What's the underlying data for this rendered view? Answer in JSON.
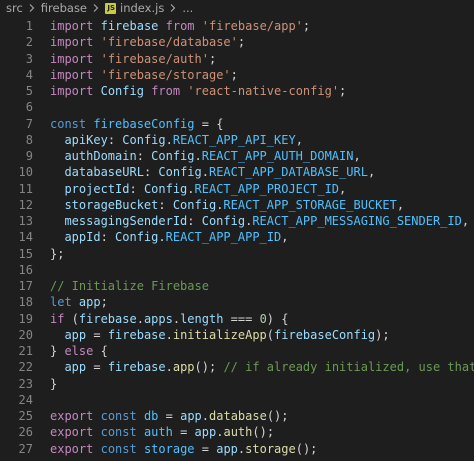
{
  "breadcrumb": {
    "items": [
      "src",
      "firebase",
      "index.js",
      "..."
    ]
  },
  "editor": {
    "lines": [
      {
        "n": "1",
        "tokens": [
          [
            "kw",
            "import"
          ],
          [
            "pun",
            " "
          ],
          [
            "var",
            "firebase"
          ],
          [
            "pun",
            " "
          ],
          [
            "kw",
            "from"
          ],
          [
            "pun",
            " "
          ],
          [
            "str",
            "'firebase/app'"
          ],
          [
            "pun",
            ";"
          ]
        ]
      },
      {
        "n": "2",
        "tokens": [
          [
            "kw",
            "import"
          ],
          [
            "pun",
            " "
          ],
          [
            "str",
            "'firebase/database'"
          ],
          [
            "pun",
            ";"
          ]
        ]
      },
      {
        "n": "3",
        "tokens": [
          [
            "kw",
            "import"
          ],
          [
            "pun",
            " "
          ],
          [
            "str",
            "'firebase/auth'"
          ],
          [
            "pun",
            ";"
          ]
        ]
      },
      {
        "n": "4",
        "tokens": [
          [
            "kw",
            "import"
          ],
          [
            "pun",
            " "
          ],
          [
            "str",
            "'firebase/storage'"
          ],
          [
            "pun",
            ";"
          ]
        ]
      },
      {
        "n": "5",
        "tokens": [
          [
            "kw",
            "import"
          ],
          [
            "pun",
            " "
          ],
          [
            "var",
            "Config"
          ],
          [
            "pun",
            " "
          ],
          [
            "kw",
            "from"
          ],
          [
            "pun",
            " "
          ],
          [
            "str",
            "'react-native-config'"
          ],
          [
            "pun",
            ";"
          ]
        ]
      },
      {
        "n": "6",
        "tokens": []
      },
      {
        "n": "7",
        "tokens": [
          [
            "kb",
            "const"
          ],
          [
            "pun",
            " "
          ],
          [
            "const",
            "firebaseConfig"
          ],
          [
            "pun",
            " = {"
          ]
        ]
      },
      {
        "n": "8",
        "tokens": [
          [
            "pun",
            "  "
          ],
          [
            "var",
            "apiKey"
          ],
          [
            "pun",
            ": "
          ],
          [
            "var",
            "Config"
          ],
          [
            "pun",
            "."
          ],
          [
            "const",
            "REACT_APP_API_KEY"
          ],
          [
            "pun",
            ","
          ]
        ]
      },
      {
        "n": "9",
        "tokens": [
          [
            "pun",
            "  "
          ],
          [
            "var",
            "authDomain"
          ],
          [
            "pun",
            ": "
          ],
          [
            "var",
            "Config"
          ],
          [
            "pun",
            "."
          ],
          [
            "const",
            "REACT_APP_AUTH_DOMAIN"
          ],
          [
            "pun",
            ","
          ]
        ]
      },
      {
        "n": "10",
        "tokens": [
          [
            "pun",
            "  "
          ],
          [
            "var",
            "databaseURL"
          ],
          [
            "pun",
            ": "
          ],
          [
            "var",
            "Config"
          ],
          [
            "pun",
            "."
          ],
          [
            "const",
            "REACT_APP_DATABASE_URL"
          ],
          [
            "pun",
            ","
          ]
        ]
      },
      {
        "n": "11",
        "tokens": [
          [
            "pun",
            "  "
          ],
          [
            "var",
            "projectId"
          ],
          [
            "pun",
            ": "
          ],
          [
            "var",
            "Config"
          ],
          [
            "pun",
            "."
          ],
          [
            "const",
            "REACT_APP_PROJECT_ID"
          ],
          [
            "pun",
            ","
          ]
        ]
      },
      {
        "n": "12",
        "tokens": [
          [
            "pun",
            "  "
          ],
          [
            "var",
            "storageBucket"
          ],
          [
            "pun",
            ": "
          ],
          [
            "var",
            "Config"
          ],
          [
            "pun",
            "."
          ],
          [
            "const",
            "REACT_APP_STORAGE_BUCKET"
          ],
          [
            "pun",
            ","
          ]
        ]
      },
      {
        "n": "13",
        "tokens": [
          [
            "pun",
            "  "
          ],
          [
            "var",
            "messagingSenderId"
          ],
          [
            "pun",
            ": "
          ],
          [
            "var",
            "Config"
          ],
          [
            "pun",
            "."
          ],
          [
            "const",
            "REACT_APP_MESSAGING_SENDER_ID"
          ],
          [
            "pun",
            ","
          ]
        ]
      },
      {
        "n": "14",
        "tokens": [
          [
            "pun",
            "  "
          ],
          [
            "var",
            "appId"
          ],
          [
            "pun",
            ": "
          ],
          [
            "var",
            "Config"
          ],
          [
            "pun",
            "."
          ],
          [
            "const",
            "REACT_APP_APP_ID"
          ],
          [
            "pun",
            ","
          ]
        ]
      },
      {
        "n": "15",
        "tokens": [
          [
            "pun",
            "};"
          ]
        ]
      },
      {
        "n": "16",
        "tokens": []
      },
      {
        "n": "17",
        "tokens": [
          [
            "cm",
            "// Initialize Firebase"
          ]
        ]
      },
      {
        "n": "18",
        "tokens": [
          [
            "kb",
            "let"
          ],
          [
            "pun",
            " "
          ],
          [
            "var",
            "app"
          ],
          [
            "pun",
            ";"
          ]
        ]
      },
      {
        "n": "19",
        "tokens": [
          [
            "kw",
            "if"
          ],
          [
            "pun",
            " ("
          ],
          [
            "var",
            "firebase"
          ],
          [
            "pun",
            "."
          ],
          [
            "var",
            "apps"
          ],
          [
            "pun",
            "."
          ],
          [
            "var",
            "length"
          ],
          [
            "pun",
            " === "
          ],
          [
            "num",
            "0"
          ],
          [
            "pun",
            ") {"
          ]
        ]
      },
      {
        "n": "20",
        "tokens": [
          [
            "pun",
            "  "
          ],
          [
            "var",
            "app"
          ],
          [
            "pun",
            " = "
          ],
          [
            "var",
            "firebase"
          ],
          [
            "pun",
            "."
          ],
          [
            "fn",
            "initializeApp"
          ],
          [
            "pun",
            "("
          ],
          [
            "var",
            "firebaseConfig"
          ],
          [
            "pun",
            ");"
          ]
        ]
      },
      {
        "n": "21",
        "tokens": [
          [
            "pun",
            "} "
          ],
          [
            "kw",
            "else"
          ],
          [
            "pun",
            " {"
          ]
        ]
      },
      {
        "n": "22",
        "tokens": [
          [
            "pun",
            "  "
          ],
          [
            "var",
            "app"
          ],
          [
            "pun",
            " = "
          ],
          [
            "var",
            "firebase"
          ],
          [
            "pun",
            "."
          ],
          [
            "fn",
            "app"
          ],
          [
            "pun",
            "(); "
          ],
          [
            "cm",
            "// if already initialized, use that one"
          ]
        ]
      },
      {
        "n": "23",
        "tokens": [
          [
            "pun",
            "}"
          ]
        ]
      },
      {
        "n": "24",
        "tokens": []
      },
      {
        "n": "25",
        "tokens": [
          [
            "kw",
            "export"
          ],
          [
            "pun",
            " "
          ],
          [
            "kb",
            "const"
          ],
          [
            "pun",
            " "
          ],
          [
            "const",
            "db"
          ],
          [
            "pun",
            " = "
          ],
          [
            "var",
            "app"
          ],
          [
            "pun",
            "."
          ],
          [
            "fn",
            "database"
          ],
          [
            "pun",
            "();"
          ]
        ]
      },
      {
        "n": "26",
        "tokens": [
          [
            "kw",
            "export"
          ],
          [
            "pun",
            " "
          ],
          [
            "kb",
            "const"
          ],
          [
            "pun",
            " "
          ],
          [
            "const",
            "auth"
          ],
          [
            "pun",
            " = "
          ],
          [
            "var",
            "app"
          ],
          [
            "pun",
            "."
          ],
          [
            "fn",
            "auth"
          ],
          [
            "pun",
            "();"
          ]
        ]
      },
      {
        "n": "27",
        "tokens": [
          [
            "kw",
            "export"
          ],
          [
            "pun",
            " "
          ],
          [
            "kb",
            "const"
          ],
          [
            "pun",
            " "
          ],
          [
            "const",
            "storage"
          ],
          [
            "pun",
            " = "
          ],
          [
            "var",
            "app"
          ],
          [
            "pun",
            "."
          ],
          [
            "fn",
            "storage"
          ],
          [
            "pun",
            "();"
          ]
        ]
      }
    ]
  }
}
